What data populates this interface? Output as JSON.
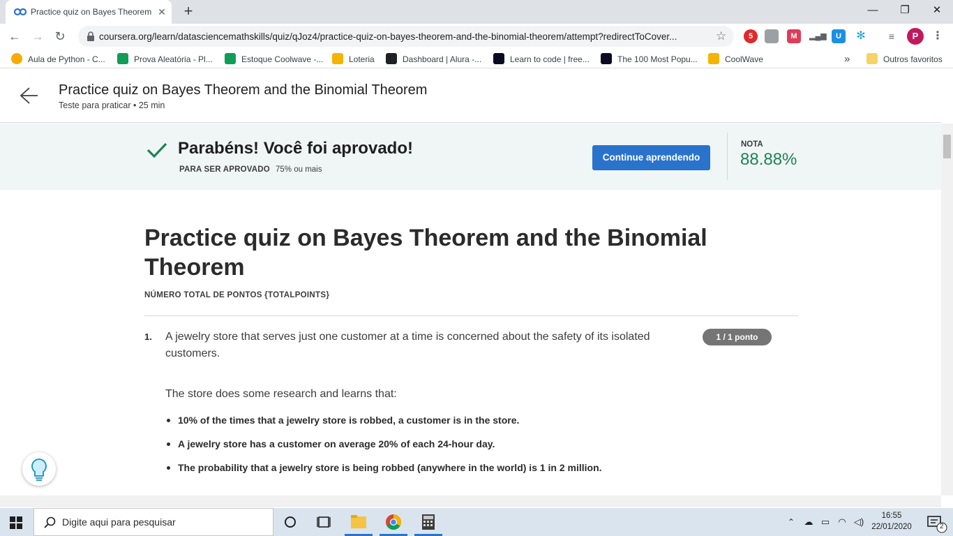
{
  "browser": {
    "tab_title": "Practice quiz on Bayes Theorem a",
    "url": "coursera.org/learn/datasciencemathskills/quiz/qJoz4/practice-quiz-on-bayes-theorem-and-the-binomial-theorem/attempt?redirectToCover...",
    "profile_initial": "P",
    "ext_badge": "5"
  },
  "bookmarks": [
    {
      "label": "Aula de Python - C..."
    },
    {
      "label": "Prova Aleatória - Pl..."
    },
    {
      "label": "Estoque Coolwave -..."
    },
    {
      "label": "Loteria"
    },
    {
      "label": "Dashboard | Alura -..."
    },
    {
      "label": "Learn to code | free..."
    },
    {
      "label": "The 100 Most Popu..."
    },
    {
      "label": "CoolWave"
    }
  ],
  "bookmarks_overflow": "»",
  "other_favorites": "Outros favoritos",
  "header": {
    "title": "Practice quiz on Bayes Theorem and the Binomial Theorem",
    "subtitle": "Teste para praticar • 25 min"
  },
  "banner": {
    "congrats": "Parabéns! Você foi aprovado!",
    "pass_label": "PARA SER APROVADO",
    "pass_value": "75% ou mais",
    "continue_label": "Continue aprendendo",
    "grade_label": "NOTA",
    "grade_value": "88.88%"
  },
  "quiz": {
    "title": "Practice quiz on Bayes Theorem and the Binomial Theorem",
    "total_points": "NÚMERO TOTAL DE PONTOS {TOTALPOINTS}",
    "question": {
      "number": "1.",
      "text": "A jewelry store that serves just one customer at a time is concerned about the safety of its isolated customers.",
      "points": "1 / 1 ponto",
      "intro": "The store does some research and learns that:",
      "bullets": [
        "10% of the times that a jewelry store is robbed, a customer is in the store.",
        "A jewelry store has a customer on average 20% of each 24-hour day.",
        "The probability that a jewelry store is being robbed (anywhere in the world) is 1 in 2 million."
      ]
    }
  },
  "taskbar": {
    "search_placeholder": "Digite aqui para pesquisar",
    "time": "16:55",
    "date": "22/01/2020",
    "notifications": "2"
  },
  "colors": {
    "accent": "#2a73cc",
    "grade": "#1f8354",
    "banner_bg": "#f0f6f6",
    "badge": "#757575"
  }
}
